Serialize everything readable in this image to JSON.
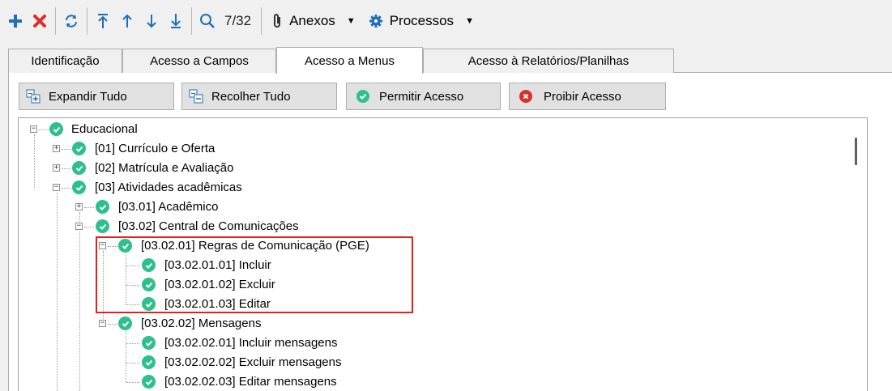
{
  "toolbar": {
    "counter": "7/32",
    "anexos": "Anexos",
    "processos": "Processos"
  },
  "tabs": [
    "Identificação",
    "Acesso a Campos",
    "Acesso a Menus",
    "Acesso à Relatórios/Planilhas"
  ],
  "actions": {
    "expand": "Expandir Tudo",
    "collapse": "Recolher Tudo",
    "allow": "Permitir Acesso",
    "deny": "Proibir Acesso"
  },
  "tree": [
    {
      "label": "Educacional",
      "expander": "-"
    },
    {
      "label": "[01] Currículo e Oferta",
      "expander": "+"
    },
    {
      "label": "[02] Matrícula e Avaliação",
      "expander": "+"
    },
    {
      "label": "[03] Atividades acadêmicas",
      "expander": "-"
    },
    {
      "label": "[03.01] Acadêmico",
      "expander": "+"
    },
    {
      "label": "[03.02] Central de Comunicações",
      "expander": "-"
    },
    {
      "label": "[03.02.01] Regras de Comunicação (PGE)",
      "expander": "-"
    },
    {
      "label": "[03.02.01.01] Incluir"
    },
    {
      "label": "[03.02.01.02] Excluir"
    },
    {
      "label": "[03.02.01.03] Editar"
    },
    {
      "label": "[03.02.02] Mensagens",
      "expander": "-"
    },
    {
      "label": "[03.02.02.01] Incluir mensagens"
    },
    {
      "label": "[03.02.02.02] Excluir mensagens"
    },
    {
      "label": "[03.02.02.03] Editar mensagens"
    }
  ],
  "colors": {
    "check": "#2ebf8f",
    "add": "#1f6fb5",
    "delete": "#d9302b",
    "highlight": "#e0221f"
  }
}
